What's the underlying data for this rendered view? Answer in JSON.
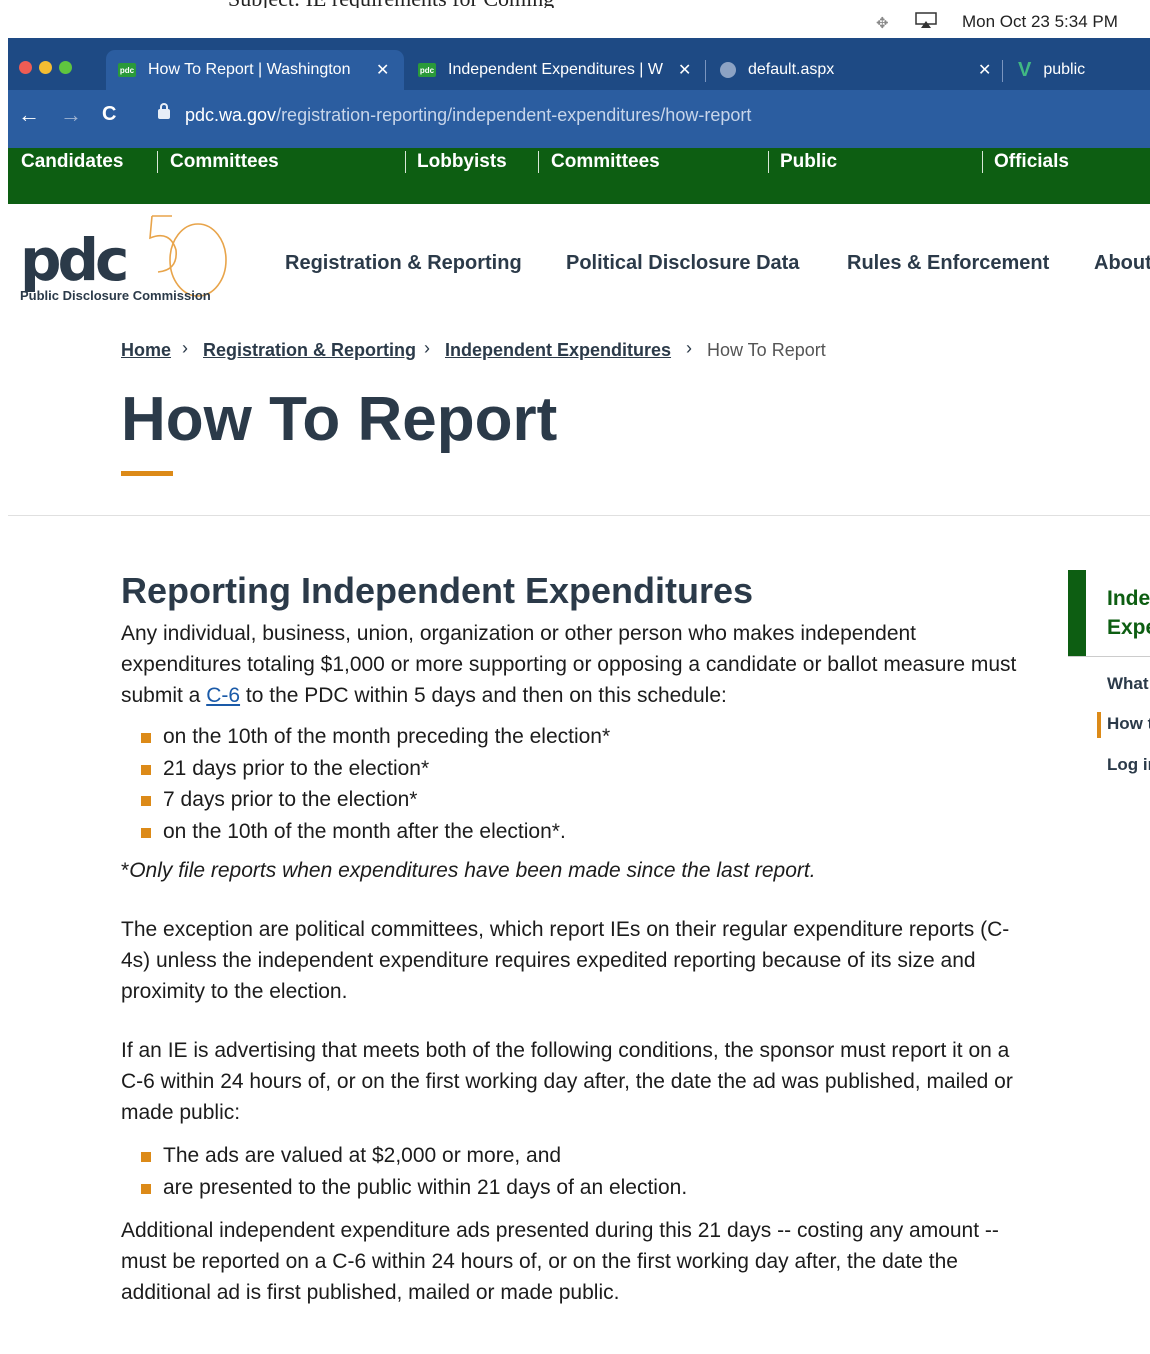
{
  "top_strip": {
    "text": "Subject: IE requirements for Coming"
  },
  "menubar": {
    "clock": "Mon Oct 23  5:34 PM",
    "icons": [
      "move-icon",
      "airplay-icon"
    ]
  },
  "browser": {
    "tabs": [
      {
        "label": "How To Report | Washington",
        "favicon": "pdc",
        "active": true
      },
      {
        "label": "Independent Expenditures | W",
        "favicon": "pdc",
        "active": false
      },
      {
        "label": "default.aspx",
        "favicon": "globe",
        "active": false
      },
      {
        "label": "public",
        "favicon": "vue",
        "active": false
      }
    ],
    "url_domain": "pdc.wa.gov",
    "url_path": "/registration-reporting/independent-expenditures/how-report"
  },
  "greennav": {
    "items": [
      "Candidates",
      "Committees",
      "Lobbyists",
      "Committees",
      "Public",
      "Officials"
    ]
  },
  "logo": {
    "wordmark": "pdc",
    "anniversary": "50",
    "subtitle": "Public Disclosure Commission"
  },
  "mainnav": {
    "items": [
      "Registration & Reporting",
      "Political Disclosure Data",
      "Rules & Enforcement",
      "About"
    ]
  },
  "breadcrumb": {
    "links": [
      "Home",
      "Registration & Reporting",
      "Independent Expenditures"
    ],
    "current": "How To Report"
  },
  "page": {
    "title": "How To Report",
    "section_heading": "Reporting Independent Expenditures",
    "intro_before_link": "Any individual, business, union, organization or other person who makes independent expenditures totaling $1,000 or more supporting or opposing a candidate or ballot measure must submit a ",
    "intro_link": "C-6",
    "intro_after_link": " to the PDC within 5 days and then on this schedule:",
    "schedule": [
      "on the 10th of the month preceding the election*",
      "21 days prior to the election*",
      "7 days prior to the election*",
      "on the 10th of the month after the election*."
    ],
    "note_star": "*",
    "note_text": "Only file reports when expenditures have been made since the last report.",
    "exception": "The exception are political committees, which report IEs on their regular expenditure reports (C-4s) unless the independent expenditure requires expedited reporting because of its size and proximity to the election.",
    "conditions_intro": "If an IE is advertising that meets both of the following conditions, the sponsor must report it on a C-6 within 24 hours of, or on the first working day after, the date the ad was published, mailed or made public:",
    "conditions": [
      "The ads are valued at $2,000 or more, and",
      "are presented to the public within 21 days of an election."
    ],
    "additional": "Additional independent expenditure ads presented during this 21 days -- costing any amount -- must be reported on a C-6 within 24 hours of, or on the first working day after, the date the additional ad is first published, mailed or made public."
  },
  "sidebar": {
    "title_line1": "Inde",
    "title_line2": "Expe",
    "links": [
      "What",
      "How t",
      "Log in"
    ]
  },
  "colors": {
    "browser_blue": "#1e4a84",
    "site_green": "#0d5e12",
    "accent_orange": "#dc8a18",
    "text_navy": "#2b3a49",
    "link_blue": "#1a5aa8"
  }
}
